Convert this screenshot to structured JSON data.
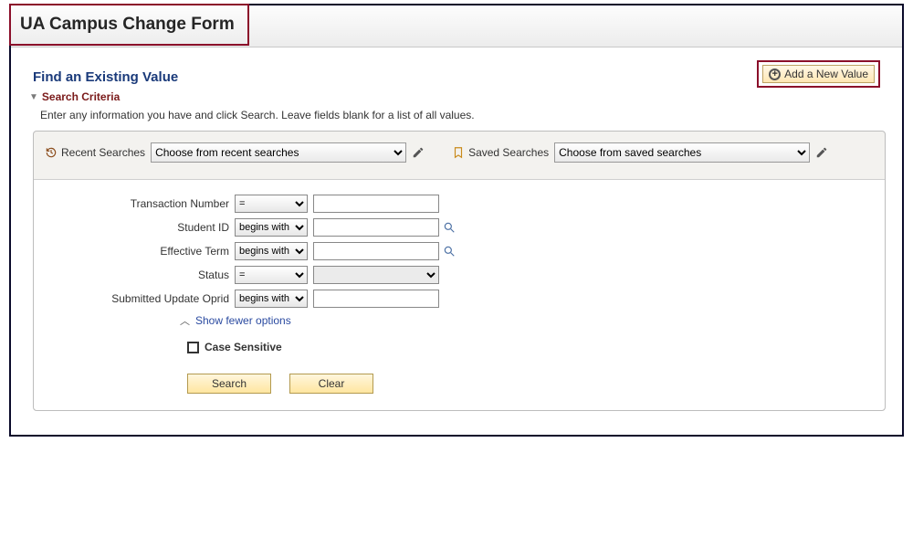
{
  "page": {
    "title": "UA Campus Change Form",
    "find_heading": "Find an Existing Value",
    "criteria_heading": "Search Criteria",
    "instructions": "Enter any information you have and click Search. Leave fields blank for a list of all values."
  },
  "add_new": {
    "label": "Add a New Value"
  },
  "recent": {
    "label": "Recent Searches",
    "placeholder": "Choose from recent searches"
  },
  "saved": {
    "label": "Saved Searches",
    "placeholder": "Choose from saved searches"
  },
  "fields": {
    "txn": {
      "label": "Transaction Number",
      "op": "="
    },
    "sid": {
      "label": "Student ID",
      "op": "begins with"
    },
    "term": {
      "label": "Effective Term",
      "op": "begins with"
    },
    "status": {
      "label": "Status",
      "op": "="
    },
    "oprid": {
      "label": "Submitted Update Oprid",
      "op": "begins with"
    }
  },
  "links": {
    "fewer": "Show fewer options",
    "case": "Case Sensitive"
  },
  "buttons": {
    "search": "Search",
    "clear": "Clear"
  }
}
